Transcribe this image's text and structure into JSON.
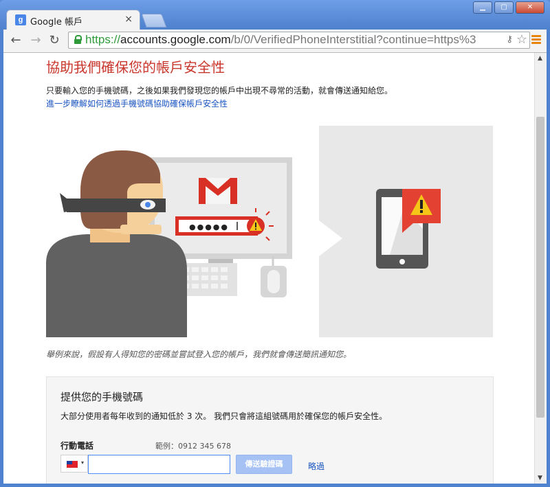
{
  "browser": {
    "tab_title": "Google 帳戶",
    "tab_favicon": "g",
    "tab_close": "×",
    "url_scheme": "https://",
    "url_host": "accounts.google.com",
    "url_path": "/b/0/VerifiedPhoneInterstitial?continue=https%3",
    "nav": {
      "back": "←",
      "forward": "→",
      "reload": "↻"
    },
    "window_buttons": {
      "minimize": "▁",
      "maximize": "▢",
      "close": "✕"
    },
    "key_glyph": "⚷",
    "star_glyph": "☆"
  },
  "page": {
    "heading": "協助我們確保您的帳戶安全性",
    "intro": "只要輸入您的手機號碼，之後如果我們發現您的帳戶中出現不尋常的活動，就會傳送通知給您。",
    "learn_more": "進一步瞭解如何透過手機號碼協助確保帳戶安全性",
    "password_dots": "●●●●●",
    "caption": "舉例來說，假設有人得知您的密碼並嘗試登入您的帳戶，我們就會傳送簡訊通知您。"
  },
  "form": {
    "title": "提供您的手機號碼",
    "description": "大部分使用者每年收到的通知低於 3 次。 我們只會將這組號碼用於確保您的帳戶安全性。",
    "phone_label": "行動電話",
    "example": "範例：0912 345 678",
    "country_caret": "▾",
    "phone_value": "",
    "send_button": "傳送驗證碼",
    "skip_link": "略過"
  },
  "colors": {
    "heading": "#c9372c",
    "link": "#1a55c1",
    "secure": "#2f9b3a",
    "button_disabled": "#a6c2f4",
    "warning": "#e34132"
  }
}
